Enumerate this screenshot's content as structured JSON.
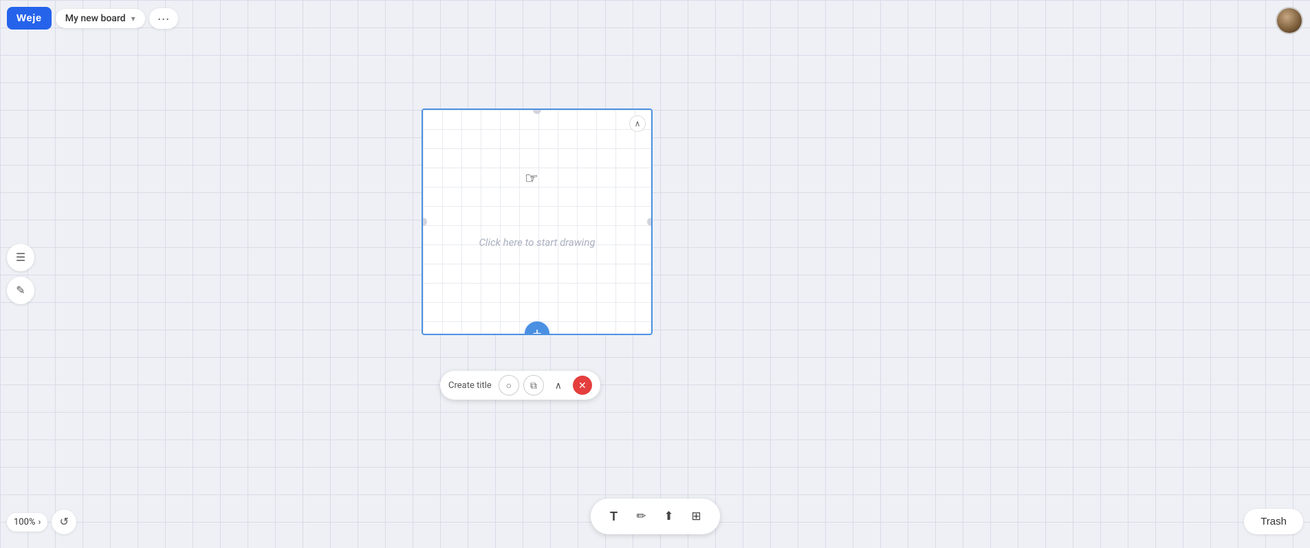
{
  "app": {
    "logo": "Weje",
    "board_name": "My new board",
    "more_icon": "···",
    "canvas_placeholder": "Click here to start drawing"
  },
  "topbar": {
    "logo_label": "Weje",
    "board_name": "My new board",
    "chevron": "▾",
    "more": "···"
  },
  "left_toolbar": {
    "menu_icon": "☰",
    "pen_icon": "✎"
  },
  "zoom": {
    "level": "100%",
    "expand_icon": "›",
    "undo_icon": "↺"
  },
  "canvas_card": {
    "placeholder": "Click here to start drawing",
    "collapse_icon": "∧"
  },
  "node_toolbar": {
    "create_title_label": "Create title",
    "circle_icon": "○",
    "copy_icon": "⧉",
    "up_icon": "∧",
    "close_icon": "✕"
  },
  "bottom_toolbar": {
    "text_icon": "T",
    "pen_icon": "✏",
    "upload_icon": "⬆",
    "layout_icon": "⊞"
  },
  "trash": {
    "label": "Trash"
  }
}
